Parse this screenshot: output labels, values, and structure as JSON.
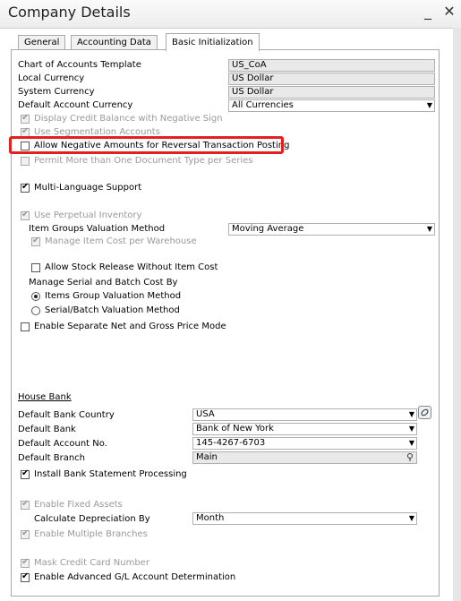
{
  "window": {
    "title": "Company Details",
    "minimize_glyph": "_",
    "close_glyph": "✕"
  },
  "tabs": [
    {
      "label": "General"
    },
    {
      "label": "Accounting Data"
    },
    {
      "label": "Basic Initialization"
    }
  ],
  "top_fields": {
    "chart_of_accounts_template": {
      "label": "Chart of Accounts Template",
      "value": "US_CoA"
    },
    "local_currency": {
      "label": "Local Currency",
      "value": "US Dollar"
    },
    "system_currency": {
      "label": "System Currency",
      "value": "US Dollar"
    },
    "default_account_currency": {
      "label": "Default Account Currency",
      "value": "All Currencies"
    }
  },
  "checkboxes": {
    "display_credit_balance": {
      "label": "Display Credit Balance with Negative Sign",
      "checked": true,
      "disabled": true
    },
    "use_segmentation": {
      "label": "Use Segmentation Accounts",
      "checked": false,
      "disabled": true
    },
    "allow_negative_amounts": {
      "label": "Allow Negative Amounts for Reversal Transaction Posting",
      "checked": false,
      "disabled": false
    },
    "permit_more_than_one_doc": {
      "label": "Permit More than One Document Type per Series",
      "checked": false,
      "disabled": true
    },
    "multi_language": {
      "label": "Multi-Language Support",
      "checked": true,
      "disabled": false
    },
    "use_perpetual_inventory": {
      "label": "Use Perpetual Inventory",
      "checked": true,
      "disabled": true
    },
    "manage_item_cost_per_warehouse": {
      "label": "Manage Item Cost per Warehouse",
      "checked": true,
      "disabled": true
    },
    "allow_stock_release": {
      "label": "Allow Stock Release Without Item Cost",
      "checked": false,
      "disabled": false
    },
    "enable_separate_net_gross": {
      "label": "Enable Separate Net and Gross Price Mode",
      "checked": false,
      "disabled": false
    },
    "install_bank_statement": {
      "label": "Install Bank Statement Processing",
      "checked": true,
      "disabled": false
    },
    "enable_fixed_assets": {
      "label": "Enable Fixed Assets",
      "checked": true,
      "disabled": true
    },
    "enable_multiple_branches": {
      "label": "Enable Multiple Branches",
      "checked": true,
      "disabled": true
    },
    "mask_credit_card": {
      "label": "Mask Credit Card Number",
      "checked": true,
      "disabled": true
    },
    "enable_advanced_gl": {
      "label": "Enable Advanced G/L Account Determination",
      "checked": true,
      "disabled": false
    }
  },
  "item_groups_valuation": {
    "label": "Item Groups Valuation Method",
    "value": "Moving Average"
  },
  "serial_batch": {
    "label": "Manage Serial and Batch Cost By",
    "options": [
      {
        "label": "Items Group Valuation Method",
        "selected": true
      },
      {
        "label": "Serial/Batch Valuation Method",
        "selected": false
      }
    ]
  },
  "house_bank": {
    "section_label": "House Bank",
    "country": {
      "label": "Default Bank Country",
      "value": "USA"
    },
    "bank": {
      "label": "Default Bank",
      "value": "Bank of New York"
    },
    "account": {
      "label": "Default Account No.",
      "value": "145-4267-6703"
    },
    "branch": {
      "label": "Default Branch",
      "value": "Main"
    }
  },
  "depreciation": {
    "label": "Calculate Depreciation By",
    "value": "Month"
  },
  "glyphs": {
    "check": "✔",
    "dropdown": "▼"
  },
  "colors": {
    "highlight": "#e32020"
  }
}
